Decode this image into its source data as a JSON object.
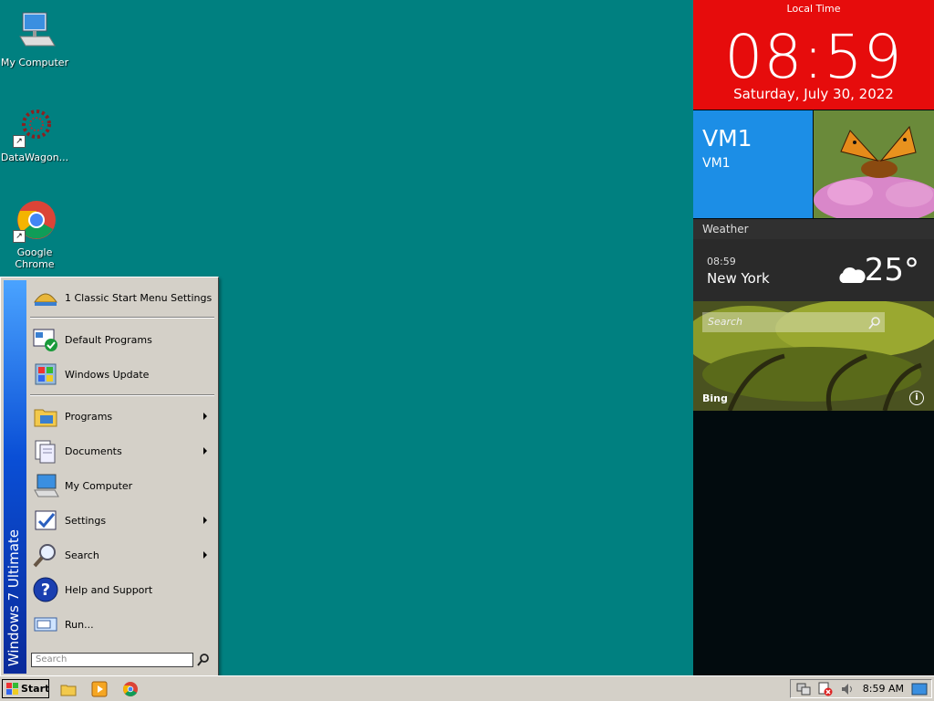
{
  "desktop": {
    "icons": [
      {
        "label": "My Computer"
      },
      {
        "label": "DataWagon..."
      },
      {
        "label": "Google Chrome"
      }
    ]
  },
  "start_menu": {
    "banner": "Windows 7 Ultimate",
    "items": [
      {
        "label": "1 Classic Start Menu Settings",
        "icon": "shell-icon"
      },
      {
        "label": "Default Programs",
        "icon": "default-programs-icon"
      },
      {
        "label": "Windows Update",
        "icon": "windows-update-icon"
      },
      {
        "label": "Programs",
        "icon": "programs-icon"
      },
      {
        "label": "Documents",
        "icon": "documents-icon"
      },
      {
        "label": "My Computer",
        "icon": "computer-icon"
      },
      {
        "label": "Settings",
        "icon": "settings-icon"
      },
      {
        "label": "Search",
        "icon": "search-icon"
      },
      {
        "label": "Help and Support",
        "icon": "help-icon"
      },
      {
        "label": "Run...",
        "icon": "run-icon"
      }
    ],
    "search_placeholder": "Search"
  },
  "taskbar": {
    "start_label": "Start",
    "clock": "8:59 AM"
  },
  "side_panel": {
    "time_label": "Local Time",
    "time": "08:59",
    "date": "Saturday, July 30, 2022",
    "vm_title": "VM1",
    "vm_subtitle": "VM1",
    "weather_header": "Weather",
    "weather_time": "08:59",
    "weather_city": "New York",
    "weather_temp": "25°",
    "bing_search_placeholder": "Search",
    "bing_label": "Bing"
  },
  "colors": {
    "desktop": "#008080",
    "time_tile": "#e60c0c",
    "vm_tile": "#1c8ee6",
    "start_banner": "#0a4fd6"
  }
}
